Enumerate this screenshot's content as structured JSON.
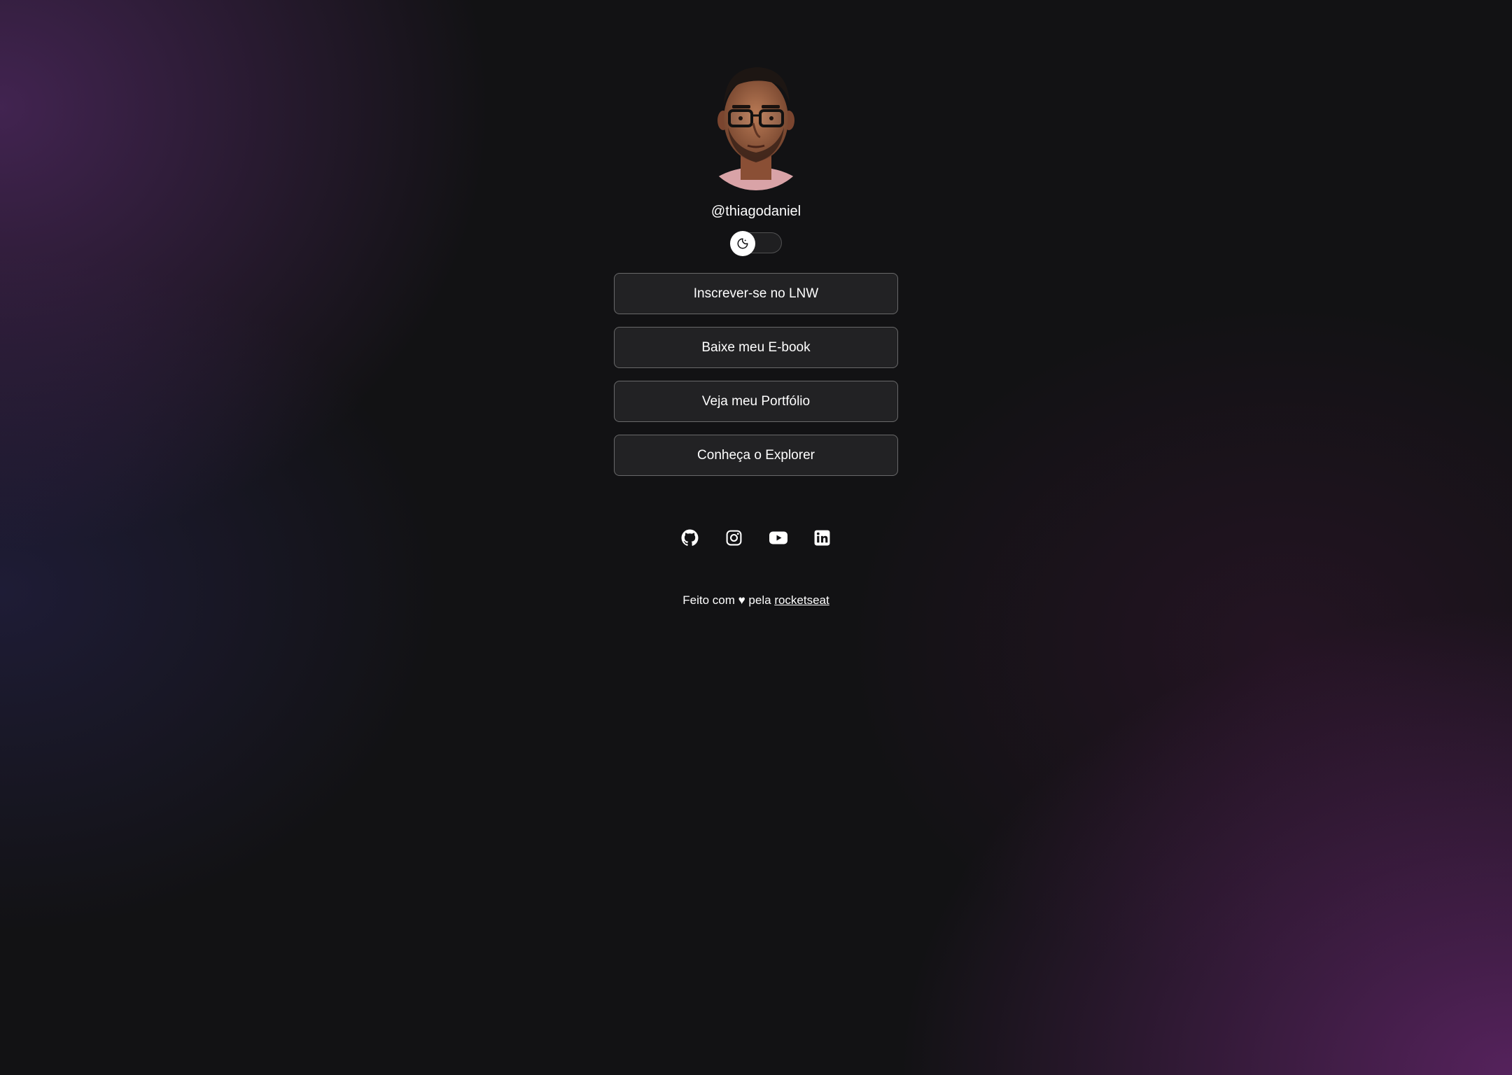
{
  "profile": {
    "username": "@thiagodaniel",
    "avatar_alt": "Thiago Daniel"
  },
  "theme_switch": {
    "icon": "moon-icon",
    "state": "dark"
  },
  "links": [
    {
      "label": "Inscrever-se no LNW"
    },
    {
      "label": "Baixe meu E-book"
    },
    {
      "label": "Veja meu Portfólio"
    },
    {
      "label": "Conheça o Explorer"
    }
  ],
  "social": [
    {
      "icon": "github-icon"
    },
    {
      "icon": "instagram-icon"
    },
    {
      "icon": "youtube-icon"
    },
    {
      "icon": "linkedin-icon"
    }
  ],
  "footer": {
    "prefix": "Feito com ♥ pela",
    "link_text": "rocketseat"
  },
  "colors": {
    "background": "#121214",
    "text": "#ffffff",
    "button_border": "rgba(255,255,255,0.32)",
    "gradient_purple": "#8c2d8c",
    "skin": "#a9694a",
    "shirt": "#d9a3a7"
  }
}
